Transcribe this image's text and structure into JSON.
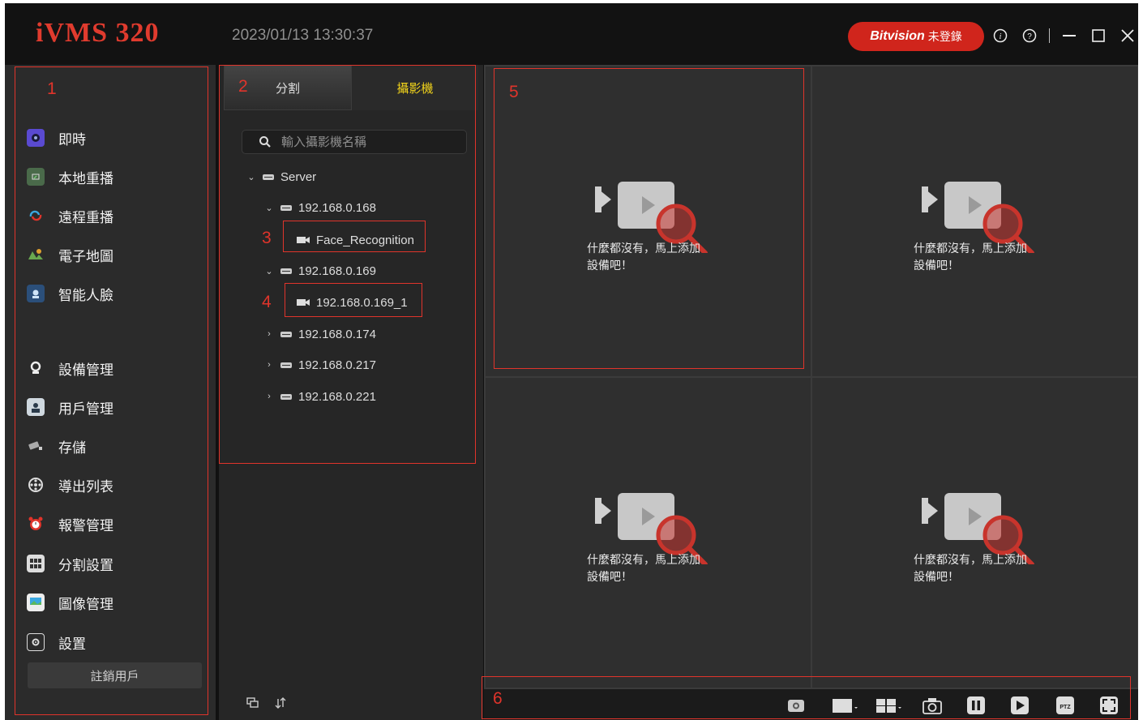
{
  "titlebar": {
    "app_title": "iVMS 320",
    "datetime": "2023/01/13 13:30:37",
    "brand": "Bitvision",
    "login_status": "未登錄",
    "icons": [
      "info-icon",
      "help-icon",
      "minimize-icon",
      "maximize-icon",
      "close-icon"
    ]
  },
  "sidebar": {
    "items": [
      {
        "label": "即時",
        "icon": "live-icon"
      },
      {
        "label": "本地重播",
        "icon": "local-playback-icon"
      },
      {
        "label": "遠程重播",
        "icon": "remote-playback-icon"
      },
      {
        "label": "電子地圖",
        "icon": "emap-icon"
      },
      {
        "label": "智能人臉",
        "icon": "face-icon"
      },
      {
        "label": "設備管理",
        "icon": "device-icon"
      },
      {
        "label": "用戶管理",
        "icon": "user-icon"
      },
      {
        "label": "存儲",
        "icon": "storage-icon"
      },
      {
        "label": "導出列表",
        "icon": "export-icon"
      },
      {
        "label": "報警管理",
        "icon": "alarm-icon"
      },
      {
        "label": "分割設置",
        "icon": "split-icon"
      },
      {
        "label": "圖像管理",
        "icon": "image-icon"
      },
      {
        "label": "設置",
        "icon": "settings-icon"
      }
    ],
    "logout_label": "註銷用戶"
  },
  "middle": {
    "tabs": [
      {
        "label": "分割"
      },
      {
        "label": "攝影機"
      }
    ],
    "search_placeholder": "輸入攝影機名稱",
    "tree": [
      {
        "label": "Server",
        "type": "server",
        "expanded": true
      },
      {
        "label": "192.168.0.168",
        "type": "nvr",
        "expanded": true
      },
      {
        "label": "Face_Recognition",
        "type": "camera"
      },
      {
        "label": "192.168.0.169",
        "type": "nvr",
        "expanded": true
      },
      {
        "label": "192.168.0.169_1",
        "type": "camera"
      },
      {
        "label": "192.168.0.174",
        "type": "nvr",
        "expanded": false
      },
      {
        "label": "192.168.0.217",
        "type": "nvr",
        "expanded": false
      },
      {
        "label": "192.168.0.221",
        "type": "nvr",
        "expanded": false
      }
    ]
  },
  "video": {
    "empty_line1": "什麼都沒有，馬上添加",
    "empty_line2": "設備吧！"
  },
  "toolbar": {
    "icons": [
      "record-icon",
      "layout-single-icon",
      "layout-quad-icon",
      "snapshot-icon",
      "pause-icon",
      "play-icon",
      "ptz-icon",
      "fullscreen-icon"
    ],
    "ptz_label": "PTZ"
  },
  "annotations": [
    "1",
    "2",
    "3",
    "4",
    "5",
    "6"
  ],
  "colors": {
    "accent": "#e03b2e",
    "active_tab": "#f0d21b",
    "brand_pill": "#d0251c"
  }
}
